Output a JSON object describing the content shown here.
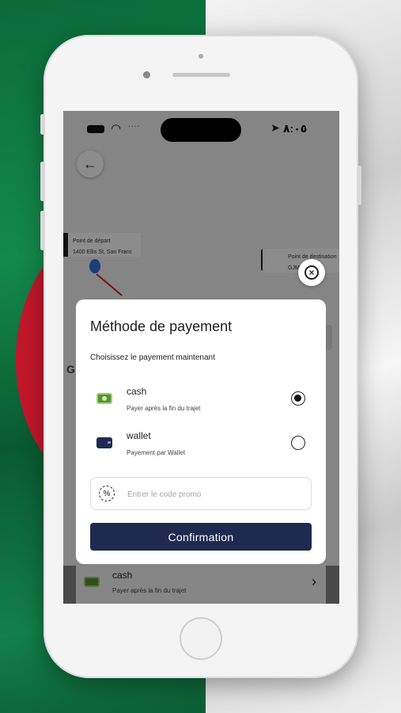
{
  "status_bar": {
    "time": "٨:٠٥"
  },
  "map": {
    "start_label": "Point de départ",
    "start_address": "1400 Ellis St, San Franc",
    "end_label": "Point de destination",
    "end_address": "GJMT",
    "side_letter": "G"
  },
  "modal": {
    "title": "Méthode de payement",
    "subtitle": "Choisissez le payement maintenant",
    "options": [
      {
        "name": "cash",
        "description": "Payer après la fin du trajet",
        "selected": true,
        "icon": "cash-icon"
      },
      {
        "name": "wallet",
        "description": "Payement par Wallet",
        "selected": false,
        "icon": "wallet-icon"
      }
    ],
    "promo_placeholder": "Entrer le code promo",
    "confirm_label": "Confirmation"
  },
  "bottom_bar": {
    "name": "cash",
    "description": "Payer après la fin du trajet"
  },
  "colors": {
    "primary": "#1e2a4f",
    "flag_green": "#138a4a",
    "flag_red": "#c2182b"
  }
}
